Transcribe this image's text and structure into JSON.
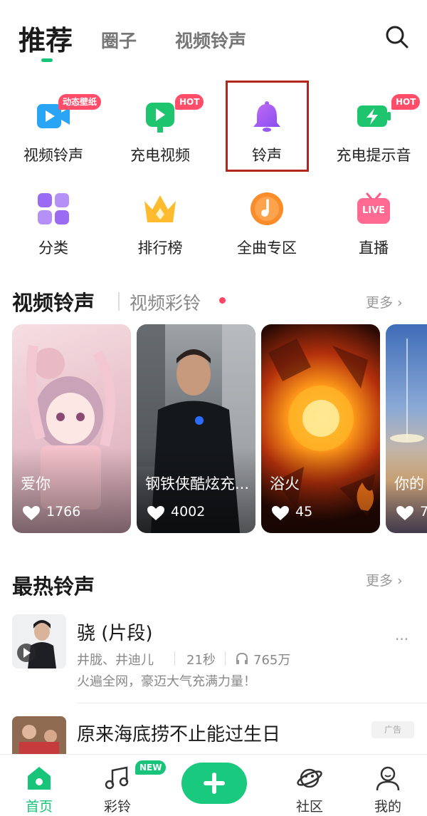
{
  "header": {
    "tabs": [
      {
        "label": "推荐",
        "active": true
      },
      {
        "label": "圈子"
      },
      {
        "label": "视频铃声"
      }
    ],
    "search_icon": "search-icon"
  },
  "grid": {
    "items": [
      {
        "label": "视频铃声",
        "icon": "video-ringtone-icon",
        "badge": "动态壁纸"
      },
      {
        "label": "充电视频",
        "icon": "charging-video-icon",
        "badge": "HOT"
      },
      {
        "label": "铃声",
        "icon": "bell-icon"
      },
      {
        "label": "充电提示音",
        "icon": "charging-sound-icon",
        "badge": "HOT"
      },
      {
        "label": "分类",
        "icon": "category-icon"
      },
      {
        "label": "排行榜",
        "icon": "crown-icon"
      },
      {
        "label": "全曲专区",
        "icon": "music-note-icon"
      },
      {
        "label": "直播",
        "icon": "live-tv-icon",
        "icon_text": "LIVE"
      }
    ]
  },
  "video_section": {
    "title": "视频铃声",
    "subtitle": "视频彩铃",
    "more": "更多 ›",
    "cards": [
      {
        "title": "爱你",
        "likes": "1766"
      },
      {
        "title": "钢铁侠酷炫充...",
        "likes": "4002"
      },
      {
        "title": "浴火",
        "likes": "45"
      },
      {
        "title": "你的",
        "likes": "7"
      }
    ]
  },
  "hot_section": {
    "title": "最热铃声",
    "more": "更多 ›",
    "songs": [
      {
        "title": "骁 (片段)",
        "artist": "井胧、井迪儿",
        "duration": "21秒",
        "plays": "765万",
        "desc": "火遍全网，豪迈大气充满力量！",
        "menu": "···"
      },
      {
        "title": "原来海底捞不止能过生日",
        "ad": "广告"
      }
    ]
  },
  "bottom_nav": {
    "items": [
      {
        "label": "首页",
        "icon": "home-icon",
        "active": true
      },
      {
        "label": "彩铃",
        "icon": "music-notes-icon",
        "badge": "NEW"
      },
      {
        "label": "",
        "icon": "plus-icon"
      },
      {
        "label": "社区",
        "icon": "planet-icon"
      },
      {
        "label": "我的",
        "icon": "profile-icon"
      }
    ]
  },
  "colors": {
    "accent": "#17c47a",
    "badge_red": "#ff4d6a",
    "highlight_box": "#b3261e"
  }
}
